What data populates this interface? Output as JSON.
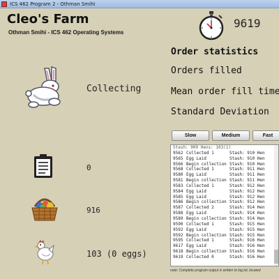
{
  "window": {
    "title": "ICS 462 Program 2 - Othman Smihi"
  },
  "header": {
    "title": "Cleo's Farm",
    "subtitle": "Othman Smihi - ICS 462 Operating Systems",
    "clock_icon": "stopwatch-icon",
    "counter": "9619"
  },
  "stats": {
    "heading": "Order statistics",
    "orders_filled": "Orders filled",
    "mean_fill_time": "Mean order fill time",
    "std_dev": "Standard Deviation"
  },
  "status": {
    "rabbit_icon": "rabbit-icon",
    "rabbit_status": "Collecting",
    "clipboard_icon": "clipboard-icon",
    "orders_value": "0",
    "basket_icon": "egg-basket-icon",
    "stash_value": "916",
    "chicken_icon": "chicken-icon",
    "chicken_value": "103 (0 eggs)"
  },
  "speed": {
    "slow": "Slow",
    "medium": "Medium",
    "fast": "Fast"
  },
  "log": {
    "header_line": "Stash: 909  Hens: 103(1)",
    "lines": [
      {
        "num": "9562",
        "msg": "Collected 1",
        "stash": "Stash: 910",
        "tail": "Hen"
      },
      {
        "num": "9565",
        "msg": "Egg Laid",
        "stash": "Stash: 910",
        "tail": "Hen"
      },
      {
        "num": "9566",
        "msg": "Begin collection",
        "stash": "Stash: 910",
        "tail": "Hen"
      },
      {
        "num": "9568",
        "msg": "Collected 1",
        "stash": "Stash: 911",
        "tail": "Hen"
      },
      {
        "num": "9580",
        "msg": "Egg Laid",
        "stash": "Stash: 911",
        "tail": "Hen"
      },
      {
        "num": "9581",
        "msg": "Begin collection",
        "stash": "Stash: 911",
        "tail": "Hen"
      },
      {
        "num": "9583",
        "msg": "Collected 1",
        "stash": "Stash: 912",
        "tail": "Hen"
      },
      {
        "num": "9584",
        "msg": "Egg Laid",
        "stash": "Stash: 912",
        "tail": "Hen"
      },
      {
        "num": "9585",
        "msg": "Egg Laid",
        "stash": "Stash: 912",
        "tail": "Hen"
      },
      {
        "num": "9586",
        "msg": "Begin collection",
        "stash": "Stash: 912",
        "tail": "Hen"
      },
      {
        "num": "9587",
        "msg": "Collected 2",
        "stash": "Stash: 914",
        "tail": "Hen"
      },
      {
        "num": "9588",
        "msg": "Egg Laid",
        "stash": "Stash: 914",
        "tail": "Hen"
      },
      {
        "num": "9589",
        "msg": "Begin collection",
        "stash": "Stash: 914",
        "tail": "Hen"
      },
      {
        "num": "9590",
        "msg": "Collected 1",
        "stash": "Stash: 915",
        "tail": "Hen"
      },
      {
        "num": "9592",
        "msg": "Egg Laid",
        "stash": "Stash: 915",
        "tail": "Hen"
      },
      {
        "num": "9592",
        "msg": "Begin collection",
        "stash": "Stash: 915",
        "tail": "Hen"
      },
      {
        "num": "9595",
        "msg": "Collected 1",
        "stash": "Stash: 916",
        "tail": "Hen"
      },
      {
        "num": "9617",
        "msg": "Egg Laid",
        "stash": "Stash: 916",
        "tail": "Hen"
      },
      {
        "num": "9618",
        "msg": "Begin collection",
        "stash": "Stash: 916",
        "tail": "Hen"
      },
      {
        "num": "9619",
        "msg": "Collected 0",
        "stash": "Stash: 916",
        "tail": "Hen"
      }
    ]
  },
  "footer": {
    "note": "note: Complete program output is written to log.txt, located"
  },
  "colors": {
    "panel_bg": "#d6d0b6",
    "titlebar": "#9fbbe0",
    "log_bg": "#ffffff"
  }
}
